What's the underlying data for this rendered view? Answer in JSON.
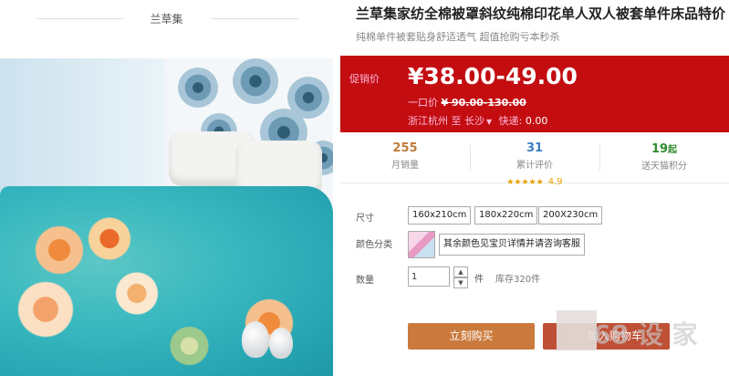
{
  "brand": {
    "name": "兰草集"
  },
  "product": {
    "title": "兰草集家纺全棉被罩斜纹纯棉印花单人双人被套单件床品特价",
    "subtitle": "纯棉单件被套贴身舒适透气 超值抢购亏本秒杀"
  },
  "price": {
    "promo_label": "促销价",
    "current": "¥38.00-49.00",
    "orig_label": "一口价",
    "orig_value": "¥ 90.00-130.00",
    "ship_from": "浙江杭州",
    "ship_to_word": "至",
    "ship_to": "长沙",
    "ship_fee_label": "快递:",
    "ship_fee": "0.00"
  },
  "stats": [
    {
      "value": "255",
      "label": "月销量",
      "color": "#c07a3a"
    },
    {
      "value": "31",
      "label": "累计评价",
      "color": "#3a7ec2",
      "stars": "★★★★★",
      "rating": "4.9"
    },
    {
      "value": "19",
      "unit": "起",
      "label": "送天猫积分",
      "color": "#2e8b2e"
    }
  ],
  "options": {
    "size_label": "尺寸",
    "sizes": [
      "160x210cm",
      "180x220cm",
      "200X230cm"
    ],
    "color_label": "颜色分类",
    "color_option": "其余颜色见宝贝详情并请咨询客服",
    "qty_label": "数量",
    "qty_value": "1",
    "qty_unit": "件",
    "stock": "库存320件"
  },
  "actions": {
    "buy": "立刻购买",
    "cart": "加入购物车"
  },
  "watermark": {
    "text": "68 设 家"
  },
  "colors": {
    "price_bg": "#c30d11",
    "buy_bg": "#cb7a3d",
    "cart_bg": "#bf5036"
  }
}
